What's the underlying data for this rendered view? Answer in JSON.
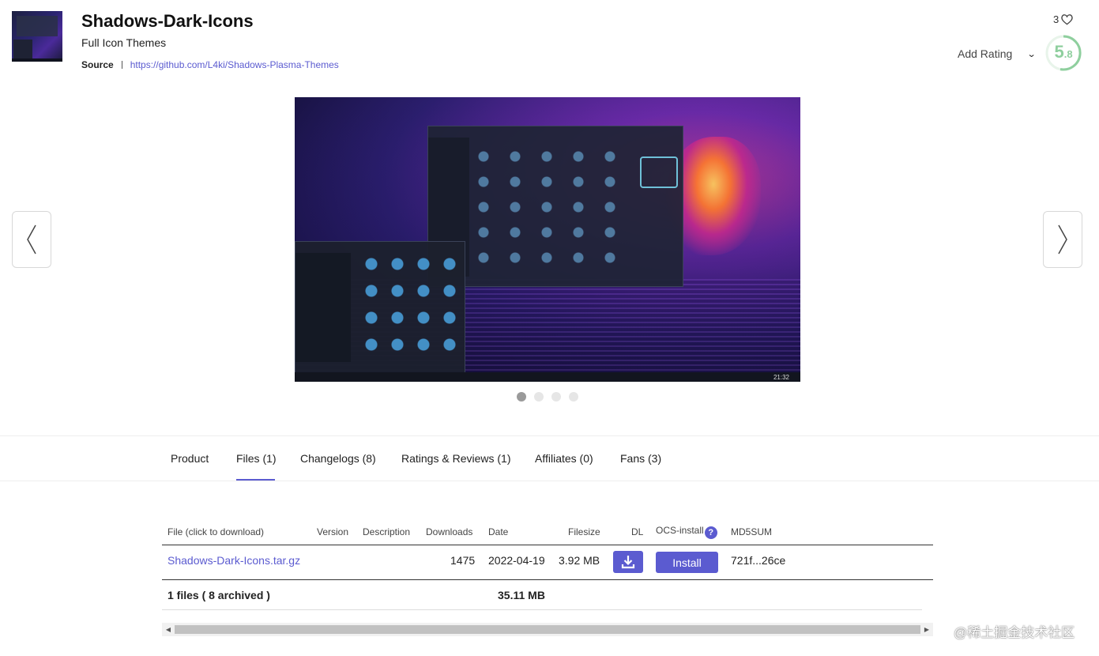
{
  "header": {
    "title": "Shadows-Dark-Icons",
    "category": "Full Icon Themes",
    "source_label": "Source",
    "source_url": "https://github.com/L4ki/Shadows-Plasma-Themes",
    "fans_count": "3",
    "add_rating_label": "Add Rating",
    "score_main": "5",
    "score_decimal": ".8",
    "score_color": "#8fcf9e"
  },
  "carousel": {
    "slides": 4,
    "active_slide": 1,
    "screenshot_clock": "21:32"
  },
  "tabs": [
    {
      "label": "Product"
    },
    {
      "label": "Files (1)"
    },
    {
      "label": "Changelogs (8)"
    },
    {
      "label": "Ratings & Reviews (1)"
    },
    {
      "label": "Affiliates (0)"
    },
    {
      "label": "Fans (3)"
    }
  ],
  "active_tab": "Files (1)",
  "files_table": {
    "headers": {
      "file": "File (click to download)",
      "version": "Version",
      "description": "Description",
      "downloads": "Downloads",
      "date": "Date",
      "filesize": "Filesize",
      "dl": "DL",
      "ocs": "OCS-install",
      "ocs_help": "?",
      "md5": "MD5SUM"
    },
    "rows": [
      {
        "file": "Shadows-Dark-Icons.tar.gz",
        "version": "",
        "description": "",
        "downloads": "1475",
        "date": "2022-04-19",
        "filesize": "3.92 MB",
        "install_label": "Install",
        "md5": "721f...26ce"
      }
    ],
    "footer": {
      "summary": "1 files ( 8 archived )",
      "total_size": "35.11 MB"
    }
  },
  "watermark": "@稀土掘金技术社区",
  "colors": {
    "accent": "#5b5bd0",
    "score": "#8fcf9e"
  }
}
